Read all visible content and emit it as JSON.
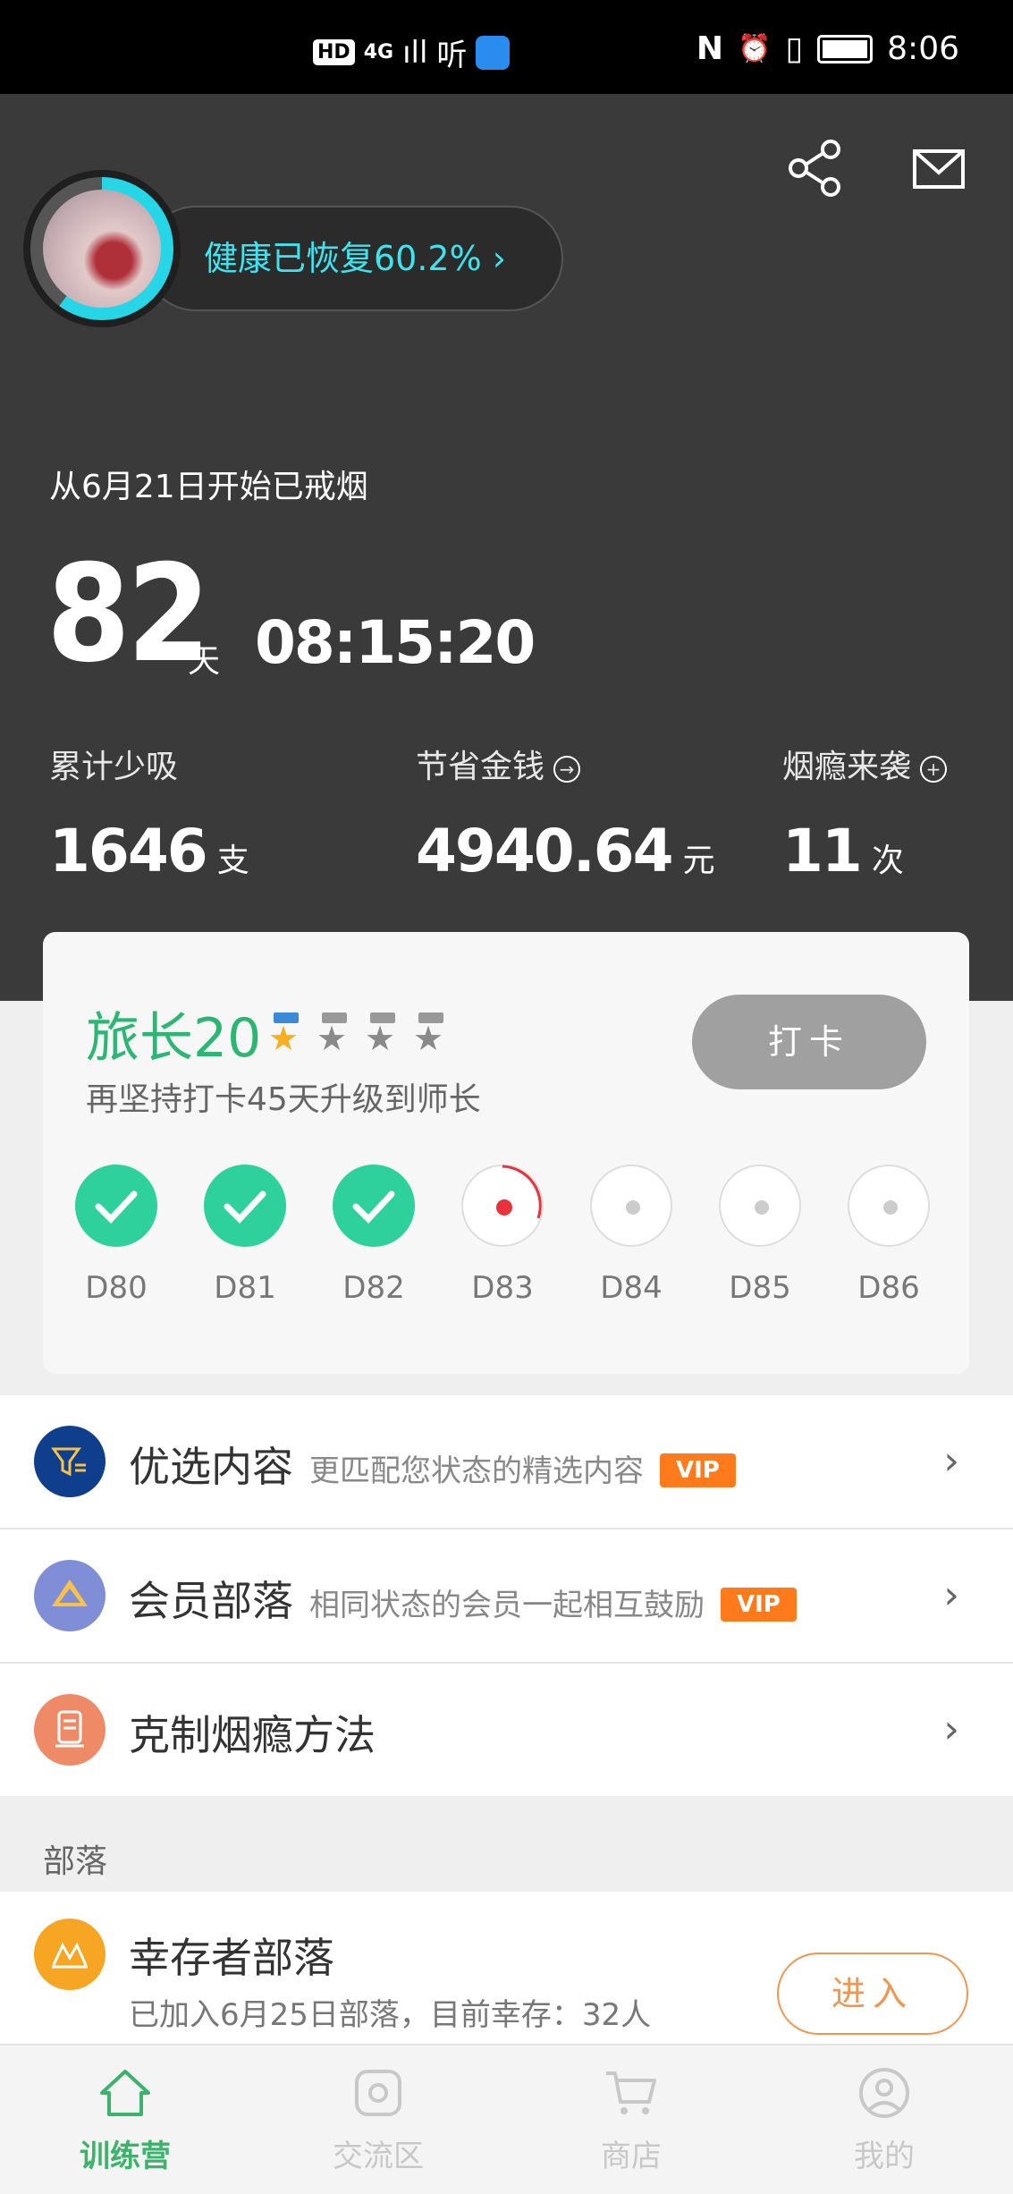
{
  "status_bar": {
    "left_badge": "HD",
    "network": "4G",
    "signal": "ıll",
    "app_label": "听",
    "nfc": "N",
    "alarm": "⏰",
    "vibrate": "▯",
    "time": "8:06"
  },
  "header": {
    "health_text": "健康已恢复60.2% ›",
    "health_progress": 0.602,
    "since_text": "从6月21日开始已戒烟",
    "days": "82",
    "days_unit": "天",
    "clock": "08:15:20",
    "stats": [
      {
        "label": "累计少吸",
        "value": "1646",
        "unit": "支",
        "icon": ""
      },
      {
        "label": "节省金钱",
        "value": "4940.64",
        "unit": "元",
        "icon": "→"
      },
      {
        "label": "烟瘾来袭",
        "value": "11",
        "unit": "次",
        "icon": "+"
      }
    ]
  },
  "rank_card": {
    "title": "旅长20",
    "stars_filled": 1,
    "stars_total": 4,
    "subtitle": "再坚持打卡45天升级到师长",
    "checkin_label": "打卡",
    "days": [
      {
        "label": "D80",
        "state": "done"
      },
      {
        "label": "D81",
        "state": "done"
      },
      {
        "label": "D82",
        "state": "done"
      },
      {
        "label": "D83",
        "state": "current"
      },
      {
        "label": "D84",
        "state": "todo"
      },
      {
        "label": "D85",
        "state": "todo"
      },
      {
        "label": "D86",
        "state": "todo"
      }
    ]
  },
  "menu": [
    {
      "title": "优选内容",
      "desc": "更匹配您状态的精选内容",
      "vip": "VIP",
      "icon": "filter-icon",
      "color": "#0f3f8c"
    },
    {
      "title": "会员部落",
      "desc": "相同状态的会员一起相互鼓励",
      "vip": "VIP",
      "icon": "tribe-icon",
      "color": "#7f8ed6"
    },
    {
      "title": "克制烟瘾方法",
      "desc": "",
      "vip": "",
      "icon": "method-icon",
      "color": "#ef8a66"
    }
  ],
  "section_label": "部落",
  "tribe": {
    "title": "幸存者部落",
    "subtitle": "已加入6月25日部落，目前幸存：32人",
    "enter_label": "进入"
  },
  "tabs": [
    {
      "label": "训练营",
      "icon": "home-icon",
      "active": true
    },
    {
      "label": "交流区",
      "icon": "chat-icon",
      "active": false
    },
    {
      "label": "商店",
      "icon": "cart-icon",
      "active": false
    },
    {
      "label": "我的",
      "icon": "profile-icon",
      "active": false
    }
  ],
  "colors": {
    "accent_green": "#2bb673",
    "health_cyan": "#27d6e6",
    "vip_orange": "#ff7a1a",
    "header_bg": "#3a3a3a"
  }
}
